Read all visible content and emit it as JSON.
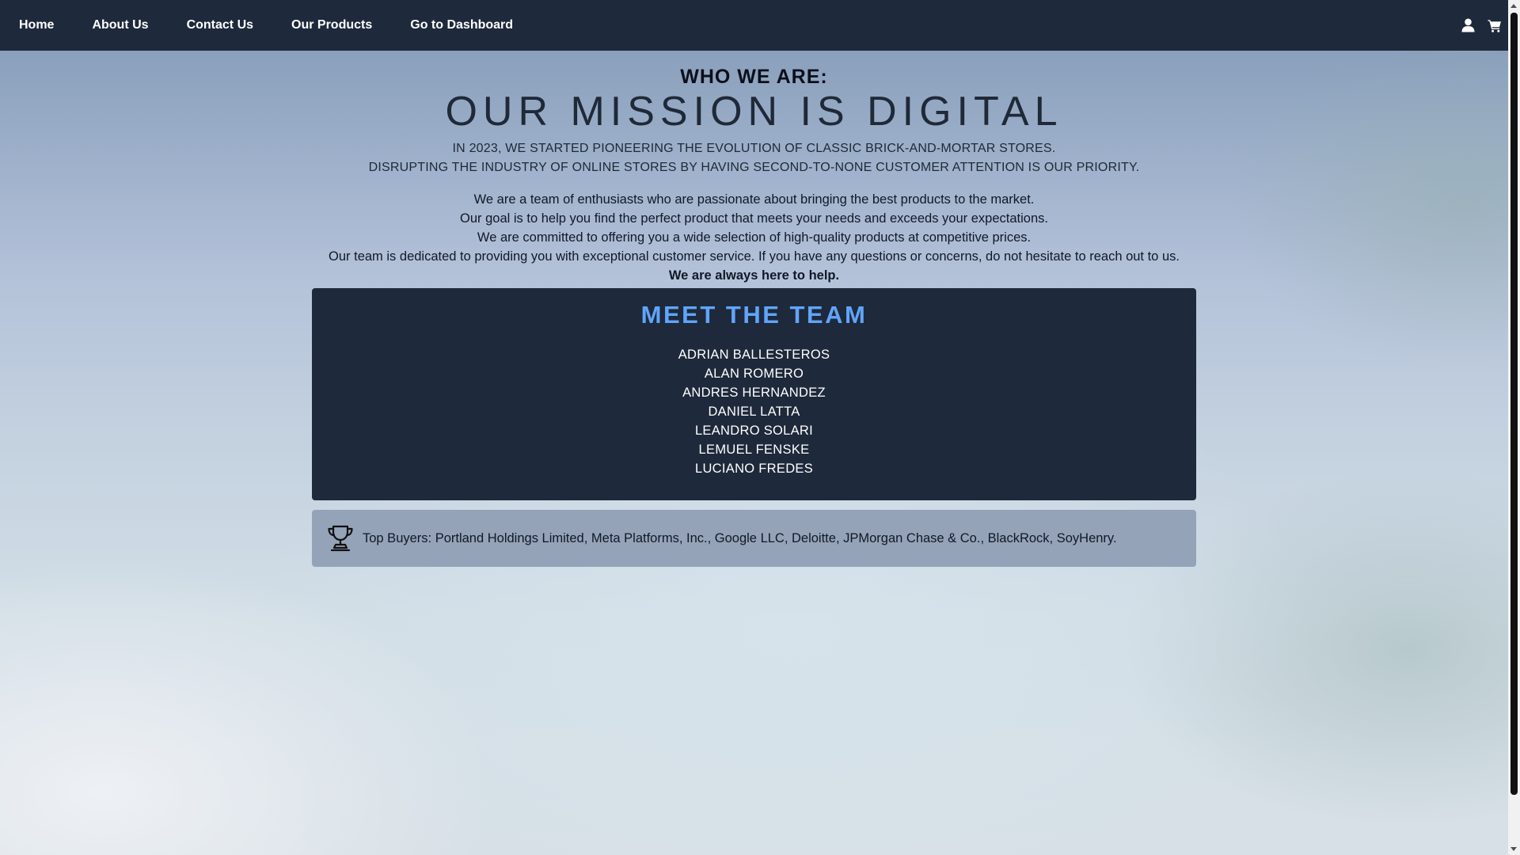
{
  "nav": {
    "links": [
      "Home",
      "About Us",
      "Contact Us",
      "Our Products",
      "Go to Dashboard"
    ],
    "icons": [
      "user-icon",
      "cart-icon"
    ]
  },
  "header": {
    "kicker": "WHO WE ARE:",
    "title": "OUR MISSION IS DIGITAL",
    "story_line1": "IN 2023, WE STARTED PIONEERING THE EVOLUTION OF CLASSIC BRICK-AND-MORTAR STORES.",
    "story_line2": "DISRUPTING THE INDUSTRY OF ONLINE STORES BY HAVING SECOND-TO-NONE CUSTOMER ATTENTION IS OUR PRIORITY."
  },
  "intro": {
    "line1": "We are a team of enthusiasts who are passionate about bringing the best products to the market.",
    "line2": "Our goal is to help you find the perfect product that meets your needs and exceeds your expectations.",
    "line3": "We are committed to offering you a wide selection of high-quality products at competitive prices.",
    "line4": "Our team is dedicated to providing you with exceptional customer service. If you have any questions or concerns, do not hesitate to reach out to us.",
    "closing": "We are always here to help."
  },
  "team": {
    "title": "MEET THE TEAM",
    "members": [
      "ADRIAN BALLESTEROS",
      "ALAN ROMERO",
      "ANDRES HERNANDEZ",
      "DANIEL LATTA",
      "LEANDRO SOLARI",
      "LEMUEL FENSKE",
      "LUCIANO FREDES"
    ]
  },
  "buyers": {
    "icon": "trophy-icon",
    "text": "Top Buyers: Portland Holdings Limited, Meta Platforms, Inc., Google LLC, Deloitte, JPMorgan Chase & Co., BlackRock, SoyHenry."
  },
  "colors": {
    "navbar_bg": "#1e293b",
    "team_title": "#60a5fa",
    "buyers_bg": "#94a3b8"
  }
}
